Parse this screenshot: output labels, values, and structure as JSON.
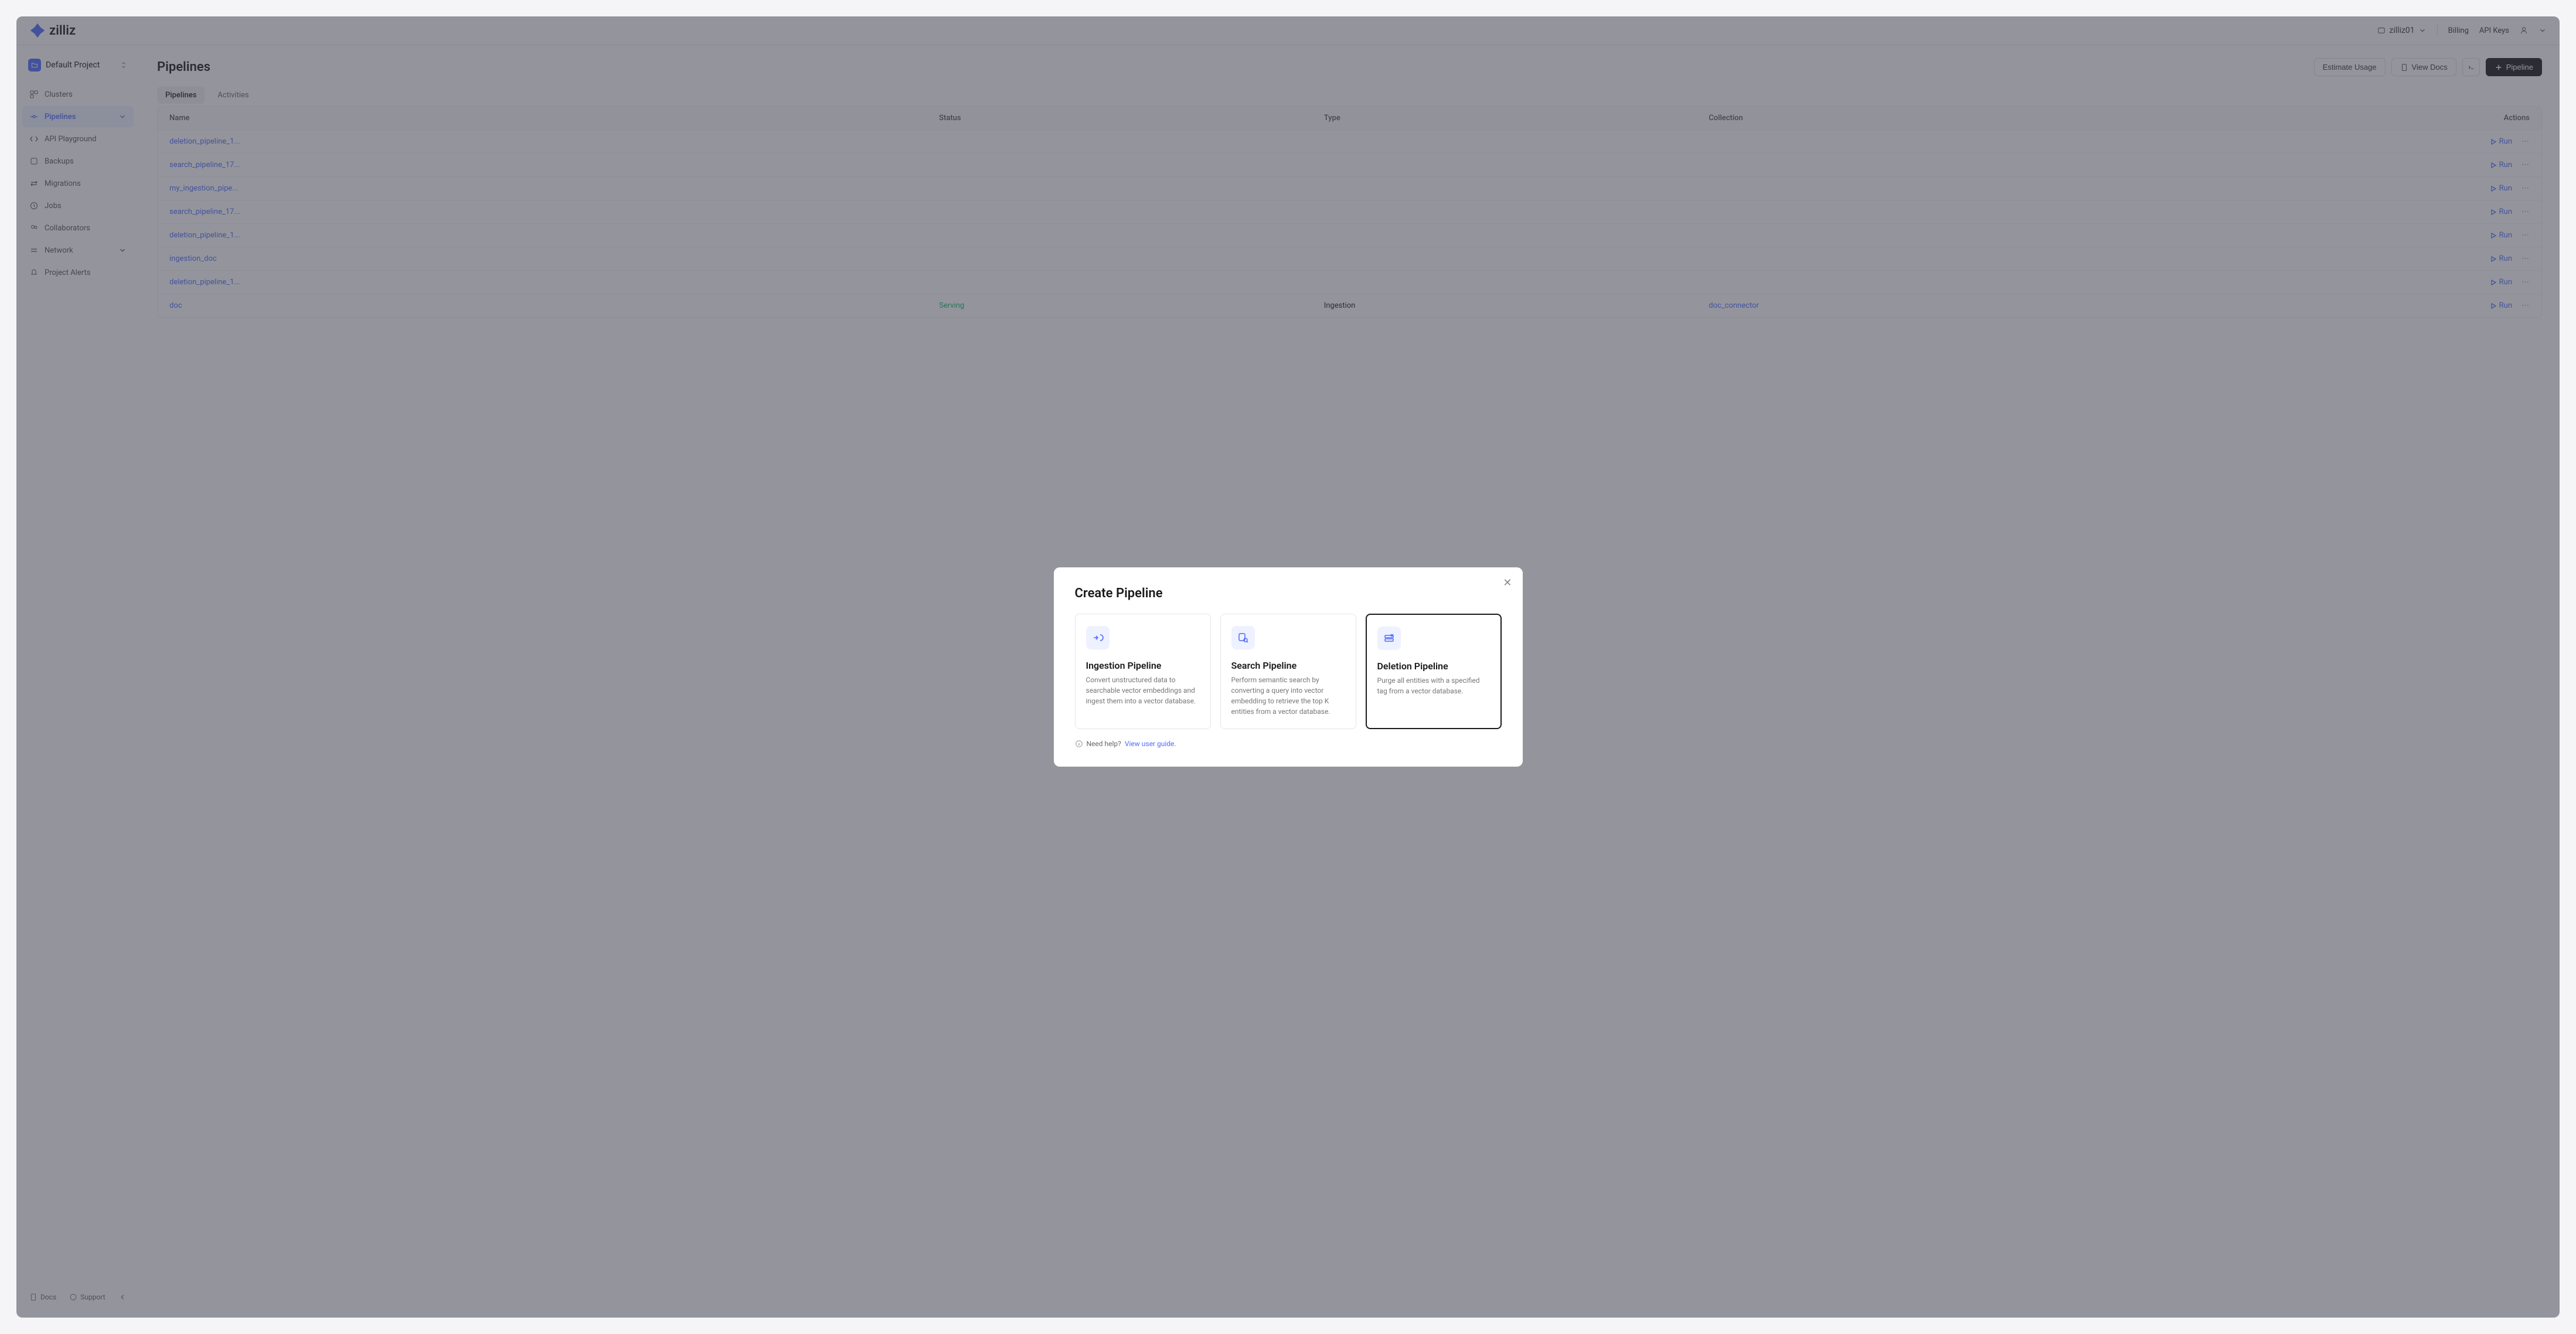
{
  "brand": "zilliz",
  "header": {
    "org": "zilliz01",
    "billing": "Billing",
    "api_keys": "API Keys"
  },
  "sidebar": {
    "project": "Default Project",
    "items": [
      {
        "label": "Clusters"
      },
      {
        "label": "Pipelines"
      },
      {
        "label": "API Playground"
      },
      {
        "label": "Backups"
      },
      {
        "label": "Migrations"
      },
      {
        "label": "Jobs"
      },
      {
        "label": "Collaborators"
      },
      {
        "label": "Network"
      },
      {
        "label": "Project Alerts"
      }
    ],
    "docs": "Docs",
    "support": "Support"
  },
  "main": {
    "title": "Pipelines",
    "estimate": "Estimate Usage",
    "view_docs": "View Docs",
    "pipeline_btn": "Pipeline",
    "tabs": {
      "pipelines": "Pipelines",
      "activities": "Activities"
    },
    "columns": {
      "name": "Name",
      "status": "Status",
      "type": "Type",
      "collection": "Collection",
      "actions": "Actions"
    },
    "run": "Run",
    "rows": [
      {
        "name": "deletion_pipeline_1...",
        "status": "",
        "type": "",
        "collection": ""
      },
      {
        "name": "search_pipeline_17...",
        "status": "",
        "type": "",
        "collection": ""
      },
      {
        "name": "my_ingestion_pipe...",
        "status": "",
        "type": "",
        "collection": ""
      },
      {
        "name": "search_pipeline_17...",
        "status": "",
        "type": "",
        "collection": ""
      },
      {
        "name": "deletion_pipeline_1...",
        "status": "",
        "type": "",
        "collection": ""
      },
      {
        "name": "ingestion_doc",
        "status": "",
        "type": "",
        "collection": ""
      },
      {
        "name": "deletion_pipeline_1...",
        "status": "",
        "type": "",
        "collection": ""
      },
      {
        "name": "doc",
        "status": "Serving",
        "type": "Ingestion",
        "collection": "doc_connector"
      }
    ]
  },
  "modal": {
    "title": "Create Pipeline",
    "cards": [
      {
        "title": "Ingestion Pipeline",
        "desc": "Convert unstructured data to searchable vector embeddings and ingest them into a vector database."
      },
      {
        "title": "Search Pipeline",
        "desc": "Perform semantic search by converting a query into vector embedding to retrieve the top K entities from a vector database."
      },
      {
        "title": "Deletion Pipeline",
        "desc": "Purge all entities with a specified tag from a vector database."
      }
    ],
    "help_prefix": "Need help? ",
    "help_link": "View user guide."
  }
}
